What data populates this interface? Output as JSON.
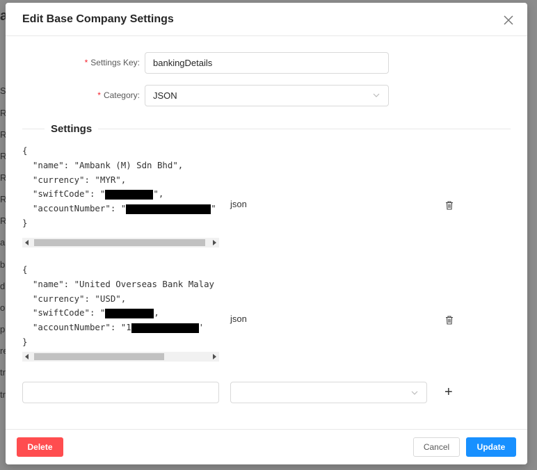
{
  "background": {
    "heading_letter": "a",
    "row_letters": [
      "S",
      "R",
      "R",
      "R",
      "R",
      "R",
      "R",
      "a",
      "b",
      "d",
      "o",
      "p",
      "re",
      "tr",
      "tr"
    ]
  },
  "modal": {
    "title": "Edit Base Company Settings",
    "close_icon": "close-icon",
    "settings_key_label": "Settings Key",
    "settings_key_value": "bankingDetails",
    "category_label": "Category",
    "category_value": "JSON",
    "section_title": "Settings",
    "entries": [
      {
        "lines": [
          "{",
          "  \"name\": \"Ambank (M) Sdn Bhd\",",
          "  \"currency\": \"MYR\",",
          "  \"swiftCode\": \"",
          "  \"accountNumber\": \"",
          "}"
        ],
        "swift_suffix": "\",",
        "account_suffix": "\"",
        "type": "json"
      },
      {
        "lines": [
          "{",
          "  \"name\": \"United Overseas Bank Malay",
          "  \"currency\": \"USD\",",
          "  \"swiftCode\": \"",
          "  \"accountNumber\": \"1",
          "}"
        ],
        "swift_suffix": ",",
        "account_suffix": "'",
        "type": "json"
      }
    ],
    "new_entry": {
      "key_value": "",
      "type_value": ""
    },
    "add_icon": "plus-icon",
    "delete_label": "Delete",
    "cancel_label": "Cancel",
    "update_label": "Update"
  },
  "colors": {
    "primary": "#1890ff",
    "danger": "#ff4d4f",
    "required": "#f5222d"
  }
}
